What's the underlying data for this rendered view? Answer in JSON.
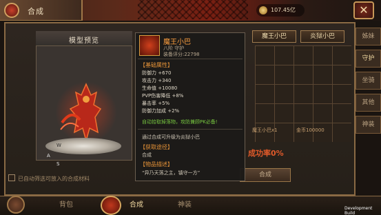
{
  "window": {
    "title": "合成",
    "currency_amount": "107.45亿",
    "close_label": "✕"
  },
  "right_tabs": [
    {
      "label": "姊妹"
    },
    {
      "label": "守护"
    },
    {
      "label": "坐骑"
    },
    {
      "label": "其他"
    },
    {
      "label": "神装"
    }
  ],
  "name_buttons": [
    {
      "label": "魔王小巴"
    },
    {
      "label": "炎狱小巴"
    }
  ],
  "preview": {
    "title": "模型预览",
    "compass_w": "W",
    "compass_a": "A",
    "compass_s": "S"
  },
  "tooltip": {
    "item_name": "魔王小巴",
    "item_sub": "八阶 守护",
    "item_score": "装备评分:22798",
    "base_header": "【基础属性】",
    "attributes": [
      "防御力 +670",
      "攻击力 +340",
      "生命值 +10080",
      "PVP伤害降低 +8%",
      "暴击率 +5%",
      "防御力加成 +2%"
    ],
    "auto_pickup": "自动拾取掉落物，攻防兼顾PK必备!",
    "upgrade_note": "通过合成可升级为炎狱小巴",
    "source_header": "【获取途径】",
    "source_value": "合成",
    "desc_header": "【物品描述】",
    "desc_value": "“异乃天落之主，镇守一方”"
  },
  "recipe": {
    "left_text": "魔王小巴x1",
    "right_text": "金币100000",
    "success_rate": "成功率0%",
    "compose_label": "合成"
  },
  "footer": {
    "auto_filter": "已自动筛选可放入的合成材料",
    "tabs": [
      {
        "label": "背包"
      },
      {
        "label": "合成"
      },
      {
        "label": "神装"
      }
    ],
    "dev_build": "Development Build"
  },
  "colors": {
    "accent_orange": "#e89438",
    "item_name": "#ffa040",
    "green_text": "#78c840",
    "success_red": "#e05a2a"
  }
}
